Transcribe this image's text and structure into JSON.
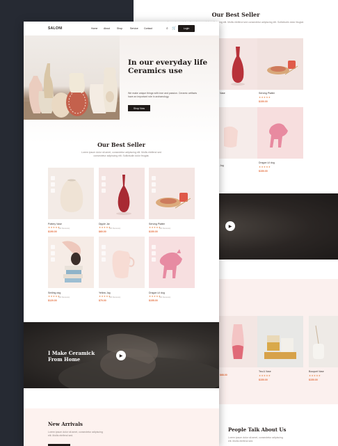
{
  "back_page": {
    "section_title": "Our Best Seller",
    "section_desc": "Lorem ipsum dolor sit amet, consectetur adipiscing elit. Mollis eleifend sed consectetur adipiscing elit. Sollicitudin dolor feugiat.",
    "products": [
      {
        "name": "Vase",
        "rating": "★★★★★",
        "price": "$68.00"
      },
      {
        "name": "Serving Platter",
        "rating": "★★★★★",
        "price": "$150.00"
      },
      {
        "name": "Jug",
        "rating": "★★★★★",
        "price": "$60.00"
      },
      {
        "name": "Dragon Lil dog",
        "rating": "★★★★★",
        "price": "$150.00"
      }
    ],
    "arrivals": [
      {
        "name": "Vase",
        "price": "$68.00"
      },
      {
        "name": "Tea & Vase",
        "rating": "★★★★★",
        "price": "$150.00"
      },
      {
        "name": "Bouquet Vase",
        "rating": "★★★★★",
        "price": "$150.00"
      }
    ],
    "testimonials_title": "People Talk About Us",
    "testimonials_desc": "Lorem ipsum dolor sit amet, consectetur adipiscing elit. Mollis eleifend sed."
  },
  "nav": {
    "logo": "SALONI",
    "links": [
      "Home",
      "About",
      "Shop",
      "Service",
      "Contact"
    ],
    "login": "Login"
  },
  "hero": {
    "title": "In our everyday life Ceramics use",
    "description": "We make unique things with love and passion. Ceramic artifacts have an important role in archaeology.",
    "cta": "Shop Now"
  },
  "best_seller": {
    "title": "Our Best Seller",
    "description": "Lorem ipsum dolor sit amet, consectetur adipiscing elit. Mollis eleifend sed consectetur adipiscing elit. Sollicitudin dolor feugiat.",
    "products": [
      {
        "name": "Pottery Vase",
        "rating": "★★★★★",
        "reviews": "(48 Reviews)",
        "price": "$190.00"
      },
      {
        "name": "Dipple Jar",
        "rating": "★★★★★",
        "reviews": "(48 Reviews)",
        "price": "$60.00"
      },
      {
        "name": "Serving Platter",
        "rating": "★★★★★",
        "reviews": "(48 Reviews)",
        "price": "$150.00"
      },
      {
        "name": "Smiling dog",
        "rating": "★★★★★",
        "reviews": "(48 Reviews)",
        "price": "$120.00"
      },
      {
        "name": "Yellow Jug",
        "rating": "★★★★★",
        "reviews": "(48 Reviews)",
        "price": "$70.00"
      },
      {
        "name": "Dragon Lil dog",
        "rating": "★★★★★",
        "reviews": "(48 Reviews)",
        "price": "$155.00"
      }
    ]
  },
  "video": {
    "title": "I Make Ceramick From Home"
  },
  "new_arrivals": {
    "title": "New Arrivals",
    "description": "Lorem ipsum dolor sit amet, consectetur adipiscing elit. Mollis eleifend sed."
  },
  "colors": {
    "accent": "#e36d3c",
    "dark": "#1f1a18",
    "pink_bg": "#fdf2ef",
    "star": "#e8894c"
  }
}
